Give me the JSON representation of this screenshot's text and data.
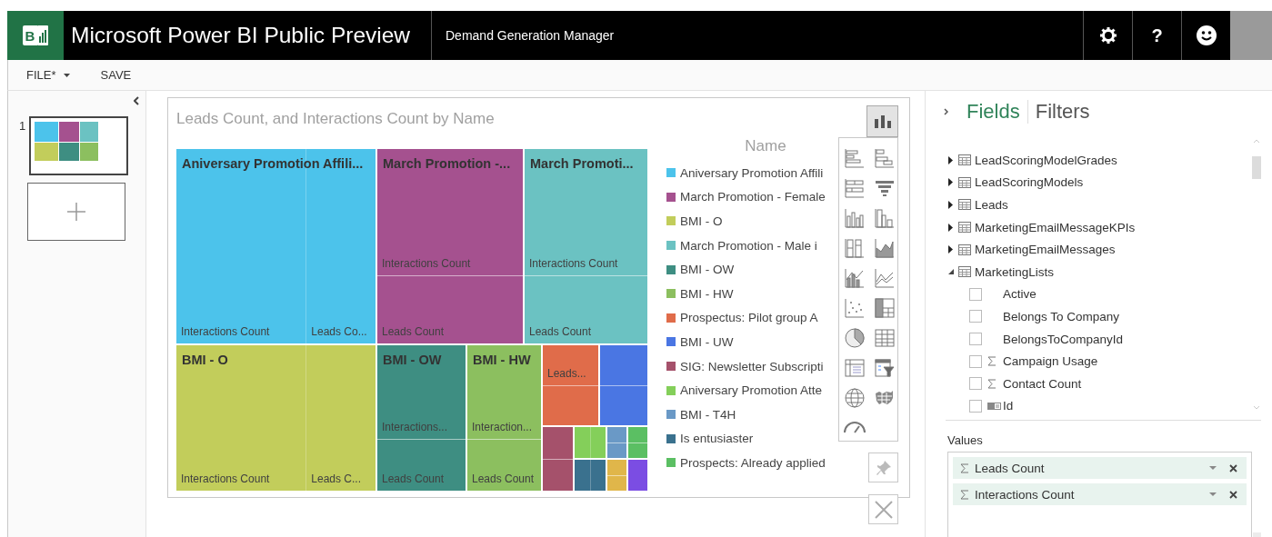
{
  "header": {
    "logo_text": "B",
    "app_title": "Microsoft Power BI Public Preview",
    "report_name": "Demand Generation Manager",
    "help_text": "?"
  },
  "toolbar": {
    "file_menu": "FILE*",
    "save": "SAVE"
  },
  "pages": [
    {
      "number": "1",
      "selected": true
    }
  ],
  "visual": {
    "title": "Leads Count, and Interactions Count by Name",
    "visual_type_button": {
      "selected": true
    },
    "treemap_rows": [
      {
        "tiles": [
          {
            "title": "Aniversary Promotion Affili...",
            "color": "#4cc3eb",
            "kind": "columns",
            "labels": [
              "Interactions Count",
              "Leads Co..."
            ]
          },
          {
            "title": "March Promotion -...",
            "color": "#a5518f",
            "kind": "rows",
            "labels": [
              "Interactions Count",
              "Leads Count"
            ]
          },
          {
            "title": "March Promoti...",
            "color": "#6bc2c2",
            "kind": "rows",
            "labels": [
              "Interactions Count",
              "Leads Count"
            ]
          }
        ]
      },
      {
        "tiles": [
          {
            "title": "BMI - O",
            "color": "#c2cd5b",
            "kind": "columns",
            "labels": [
              "Interactions Count",
              "Leads C..."
            ]
          },
          {
            "title": "BMI - OW",
            "color": "#3e8e82",
            "kind": "rows",
            "labels": [
              "Interactions...",
              "Leads Count"
            ]
          },
          {
            "title": "BMI - HW",
            "color": "#8cbf5f",
            "kind": "rows",
            "labels": [
              "Interaction...",
              "Leads Count"
            ]
          }
        ],
        "cluster": [
          {
            "color": "#e06c4a",
            "kind": "rows",
            "labels": [
              "Leads..."
            ]
          },
          {
            "color": "#4a76e3",
            "kind": "rows"
          },
          {
            "color": "#a5516b",
            "kind": "rows"
          },
          {
            "color": "#84cf5a",
            "kind": "columns"
          },
          {
            "color": "#6a99c6",
            "kind": "rows"
          },
          {
            "color": "#5bbf63",
            "kind": "rows"
          },
          {
            "color": "#3a718e",
            "kind": "columns"
          },
          {
            "color": "#e0b64a",
            "kind": "rows"
          },
          {
            "color": "#7b4de3",
            "kind": "single"
          }
        ]
      }
    ],
    "legend": {
      "title": "Name",
      "items": [
        {
          "label": "Aniversary Promotion Affili",
          "color": "#4cc3eb"
        },
        {
          "label": "March Promotion - Female",
          "color": "#a5518f"
        },
        {
          "label": "BMI - O",
          "color": "#c2cd5b"
        },
        {
          "label": "March Promotion - Male i",
          "color": "#6bc2c2"
        },
        {
          "label": "BMI - OW",
          "color": "#3e8e82"
        },
        {
          "label": "BMI - HW",
          "color": "#8cbf5f"
        },
        {
          "label": "Prospectus: Pilot group A",
          "color": "#e06c4a"
        },
        {
          "label": "BMI - UW",
          "color": "#4a76e3"
        },
        {
          "label": "SIG: Newsletter Subscripti",
          "color": "#a5516b"
        },
        {
          "label": "Aniversary Promotion Atte",
          "color": "#84cf5a"
        },
        {
          "label": "BMI - T4H",
          "color": "#6a99c6"
        },
        {
          "label": "Is entusiaster",
          "color": "#3a718e"
        },
        {
          "label": "Prospects: Already applied",
          "color": "#5bbf63"
        }
      ]
    }
  },
  "fields_pane": {
    "tabs": [
      {
        "label": "Fields",
        "selected": true
      },
      {
        "label": "Filters",
        "selected": false
      }
    ],
    "tables": [
      {
        "name": "LeadScoringModelGrades",
        "expanded": false
      },
      {
        "name": "LeadScoringModels",
        "expanded": false
      },
      {
        "name": "Leads",
        "expanded": false
      },
      {
        "name": "MarketingEmailMessageKPIs",
        "expanded": false
      },
      {
        "name": "MarketingEmailMessages",
        "expanded": false
      },
      {
        "name": "MarketingLists",
        "expanded": true,
        "children": [
          {
            "name": "Active",
            "kind": "plain",
            "checked": false
          },
          {
            "name": "Belongs To Company",
            "kind": "plain",
            "checked": false
          },
          {
            "name": "BelongsToCompanyId",
            "kind": "plain",
            "checked": false
          },
          {
            "name": "Campaign Usage",
            "kind": "sum",
            "checked": false
          },
          {
            "name": "Contact Count",
            "kind": "sum",
            "checked": false
          },
          {
            "name": "Id",
            "kind": "key",
            "checked": false
          }
        ]
      }
    ],
    "values_label": "Values",
    "values": [
      {
        "label": "Leads Count"
      },
      {
        "label": "Interactions Count"
      }
    ]
  }
}
